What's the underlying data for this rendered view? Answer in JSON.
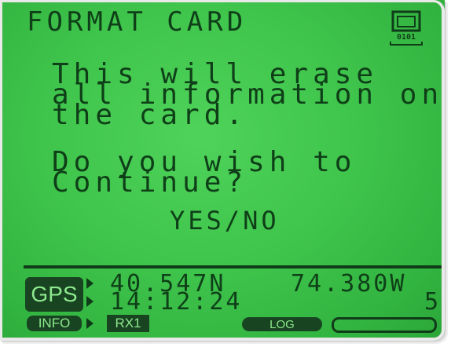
{
  "header": {
    "title": "FORMAT CARD",
    "card_icon_text": "0101"
  },
  "message": {
    "line1": "This will erase",
    "line2": "all information on",
    "line3": "the card.",
    "line4": "Do you wish to",
    "line5": "Continue?"
  },
  "prompt": {
    "yes_no": "YES/NO"
  },
  "status": {
    "gps_label": "GPS",
    "latitude": "40.547N",
    "longitude": "74.380W",
    "time": "14:12:24",
    "satellites": "5",
    "info_label": "INFO",
    "rx_label": "RX1",
    "log_label": "LOG",
    "progress": 0
  },
  "colors": {
    "lcd_background": "#3fc44c",
    "lcd_text": "#0f3f18",
    "badge_text": "#8ee88e"
  }
}
